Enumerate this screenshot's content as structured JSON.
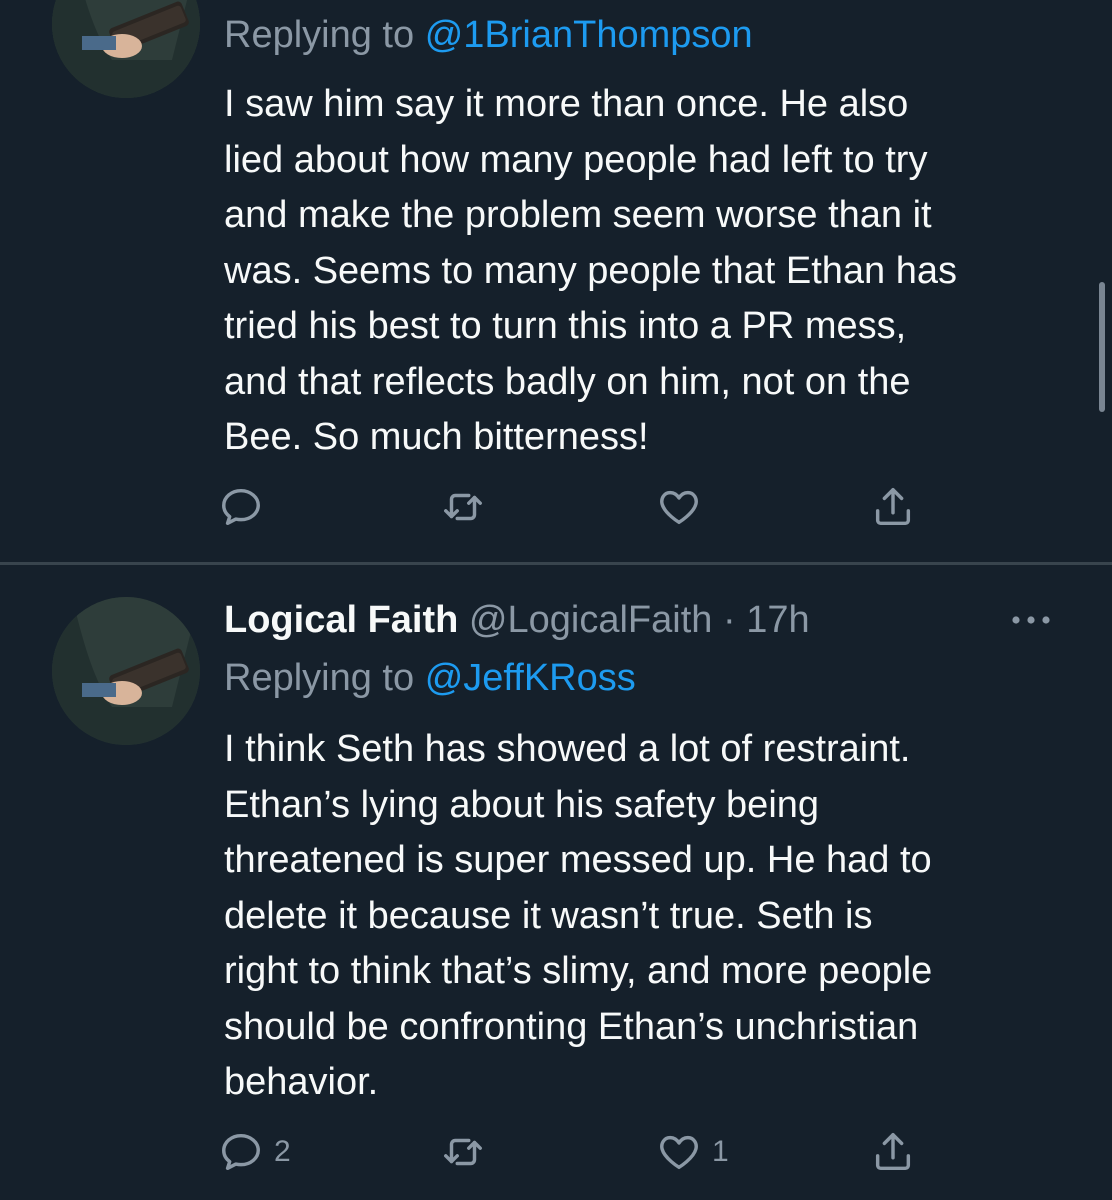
{
  "tweet1": {
    "replying_label": "Replying to",
    "replying_mention": "@1BrianThompson",
    "text": "I saw him say it more than once. He also\nlied about how many people had left to try\nand make the problem seem worse than it\nwas. Seems to many people that Ethan has\ntried his best to turn this into a PR mess,\nand that reflects badly on him, not on the\nBee. So much bitterness!",
    "actions": {
      "reply_icon": "reply-icon",
      "retweet_icon": "retweet-icon",
      "like_icon": "heart-icon",
      "share_icon": "share-icon"
    }
  },
  "tweet2": {
    "display_name": "Logical Faith",
    "handle": "@LogicalFaith",
    "separator": "·",
    "time": "17h",
    "more_icon": "more-horizontal-icon",
    "replying_label": "Replying to",
    "replying_mention": "@JeffKRoss",
    "text": "I think Seth has showed a lot of restraint.\nEthan’s lying about his safety being\nthreatened is super messed up. He had to\ndelete it because it wasn’t true. Seth is\nright to think that’s slimy, and more people\nshould be confronting Ethan’s unchristian\nbehavior.",
    "reply_count": "2",
    "like_count": "1"
  },
  "colors": {
    "background": "#15202b",
    "text_primary": "#f7f9f9",
    "text_secondary": "#8b98a5",
    "accent_link": "#1d9bf0",
    "divider": "#38444d"
  }
}
